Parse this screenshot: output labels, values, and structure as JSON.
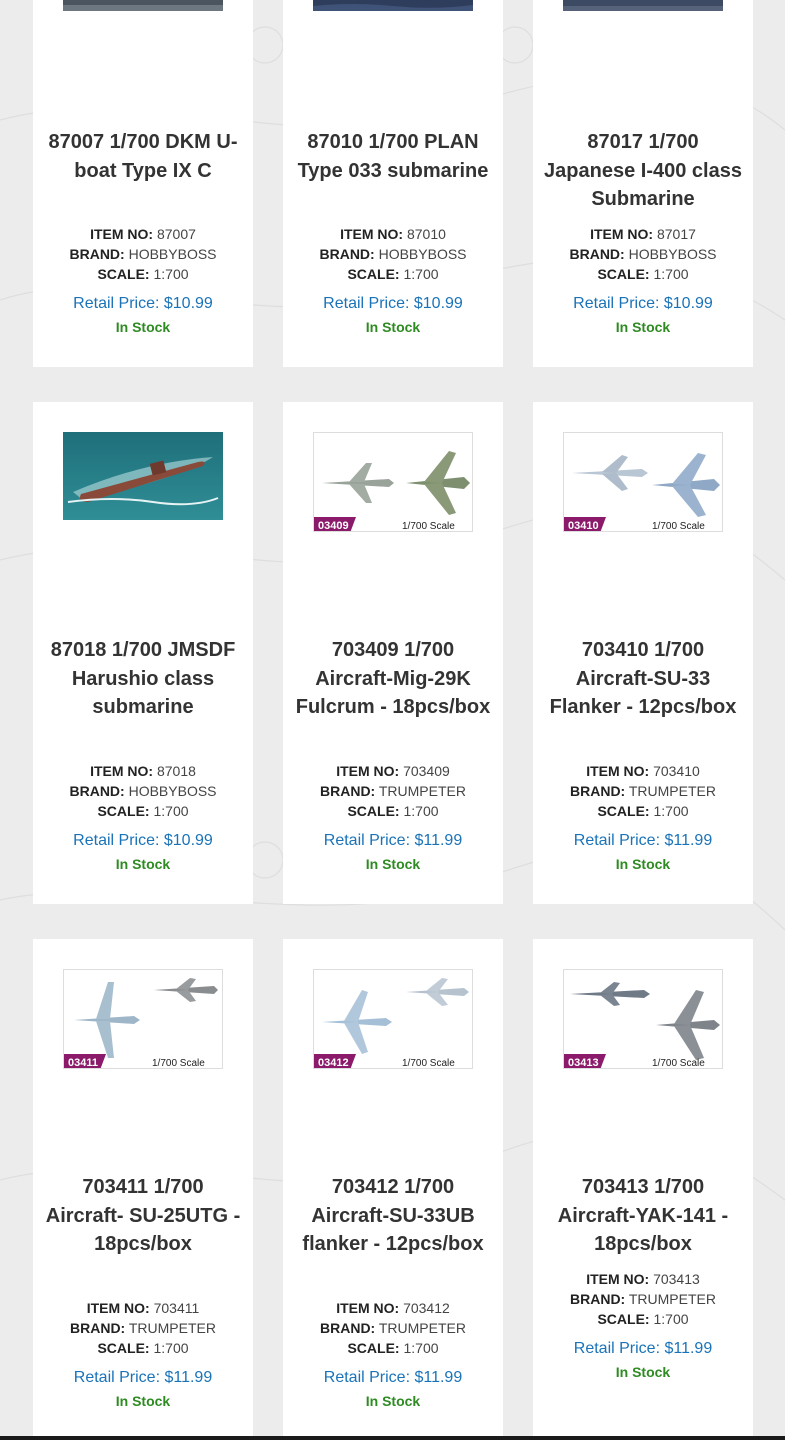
{
  "products": [
    {
      "title": "87007 1/700 DKM U-boat Type IX C",
      "item_label": "ITEM NO:",
      "item": "87007",
      "brand_label": "BRAND:",
      "brand": "HOBBYBOSS",
      "scale_label": "SCALE:",
      "scale": "1:700",
      "price": "Retail Price: $10.99",
      "stock": "In Stock"
    },
    {
      "title": "87010 1/700 PLAN Type 033 submarine",
      "item_label": "ITEM NO:",
      "item": "87010",
      "brand_label": "BRAND:",
      "brand": "HOBBYBOSS",
      "scale_label": "SCALE:",
      "scale": "1:700",
      "price": "Retail Price: $10.99",
      "stock": "In Stock"
    },
    {
      "title": "87017 1/700 Japanese I-400 class Submarine",
      "item_label": "ITEM NO:",
      "item": "87017",
      "brand_label": "BRAND:",
      "brand": "HOBBYBOSS",
      "scale_label": "SCALE:",
      "scale": "1:700",
      "price": "Retail Price: $10.99",
      "stock": "In Stock"
    },
    {
      "title": "87018 1/700 JMSDF Harushio class submarine",
      "item_label": "ITEM NO:",
      "item": "87018",
      "brand_label": "BRAND:",
      "brand": "HOBBYBOSS",
      "scale_label": "SCALE:",
      "scale": "1:700",
      "price": "Retail Price: $10.99",
      "stock": "In Stock"
    },
    {
      "title": "703409 1/700 Aircraft-Mig-29K Fulcrum - 18pcs/box",
      "item_label": "ITEM NO:",
      "item": "703409",
      "brand_label": "BRAND:",
      "brand": "TRUMPETER",
      "scale_label": "SCALE:",
      "scale": "1:700",
      "price": "Retail Price: $11.99",
      "stock": "In Stock",
      "badge": "03409",
      "badge_scale": "1/700 Scale"
    },
    {
      "title": "703410 1/700 Aircraft-SU-33 Flanker - 12pcs/box",
      "item_label": "ITEM NO:",
      "item": "703410",
      "brand_label": "BRAND:",
      "brand": "TRUMPETER",
      "scale_label": "SCALE:",
      "scale": "1:700",
      "price": "Retail Price: $11.99",
      "stock": "In Stock",
      "badge": "03410",
      "badge_scale": "1/700 Scale"
    },
    {
      "title": "703411 1/700 Aircraft- SU-25UTG - 18pcs/box",
      "item_label": "ITEM NO:",
      "item": "703411",
      "brand_label": "BRAND:",
      "brand": "TRUMPETER",
      "scale_label": "SCALE:",
      "scale": "1:700",
      "price": "Retail Price: $11.99",
      "stock": "In Stock",
      "badge": "03411",
      "badge_scale": "1/700 Scale"
    },
    {
      "title": "703412 1/700 Aircraft-SU-33UB flanker - 12pcs/box",
      "item_label": "ITEM NO:",
      "item": "703412",
      "brand_label": "BRAND:",
      "brand": "TRUMPETER",
      "scale_label": "SCALE:",
      "scale": "1:700",
      "price": "Retail Price: $11.99",
      "stock": "In Stock",
      "badge": "03412",
      "badge_scale": "1/700 Scale"
    },
    {
      "title": "703413 1/700 Aircraft-YAK-141 - 18pcs/box",
      "item_label": "ITEM NO:",
      "item": "703413",
      "brand_label": "BRAND:",
      "brand": "TRUMPETER",
      "scale_label": "SCALE:",
      "scale": "1:700",
      "price": "Retail Price: $11.99",
      "stock": "In Stock",
      "badge": "03413",
      "badge_scale": "1/700 Scale"
    }
  ],
  "colors": {
    "price": "#1a73b8",
    "stock": "#2e8b22",
    "badge": "#8b1a6b"
  }
}
